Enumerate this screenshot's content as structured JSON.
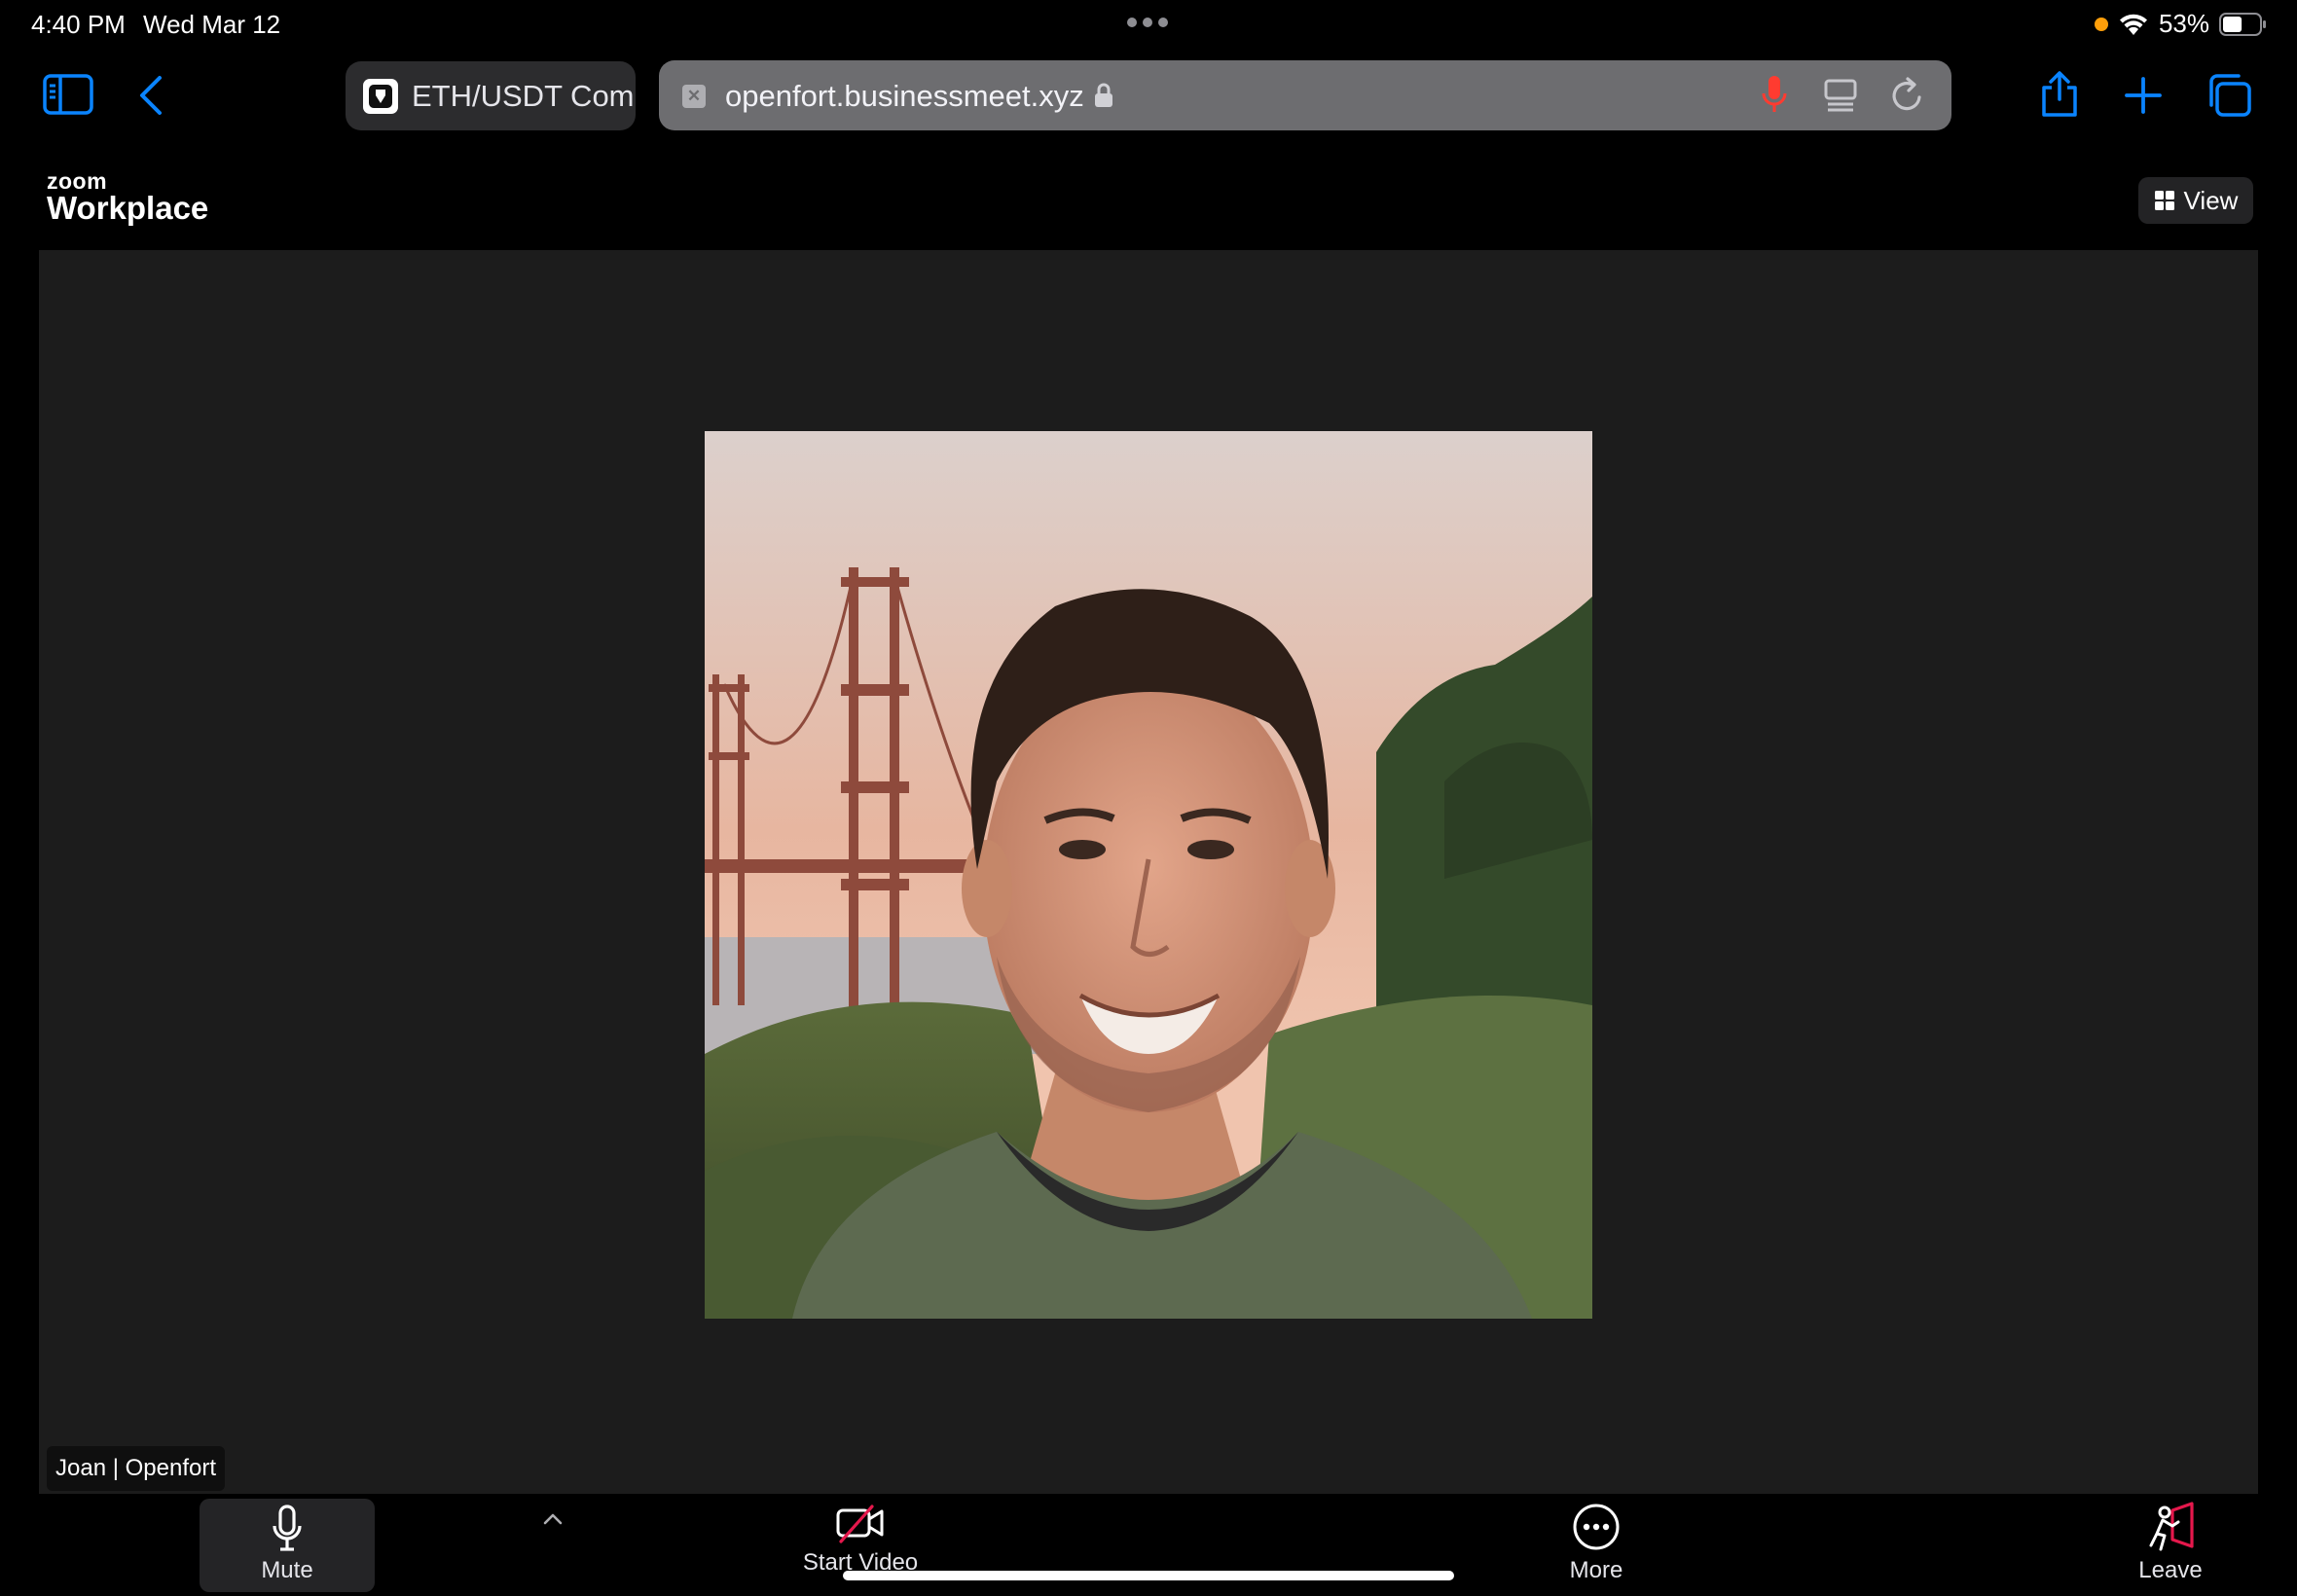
{
  "status_bar": {
    "time": "4:40 PM",
    "date": "Wed Mar 12",
    "battery_percent": "53%",
    "battery_level": 0.53,
    "icons": [
      "multitask-dots-icon",
      "orange-privacy-dot",
      "wifi-icon",
      "battery-icon"
    ]
  },
  "safari": {
    "tab_title": "ETH/USDT Com",
    "url": "openfort.businessmeet.xyz",
    "icons": [
      "sidebar-icon",
      "back-chevron-icon",
      "favicon",
      "tab-close-icon",
      "lock-icon",
      "microphone-icon",
      "reader-icon",
      "reload-icon",
      "share-icon",
      "new-tab-plus-icon",
      "tab-overview-icon"
    ],
    "colors": {
      "accent": "#0a84ff",
      "mic": "#ff3b30"
    }
  },
  "zoom": {
    "logo_small": "zoom",
    "logo_large": "Workplace",
    "view_label": "View",
    "participant_name": "Joan | Openfort",
    "toolbar": {
      "mute_label": "Mute",
      "video_label": "Start Video",
      "more_label": "More",
      "leave_label": "Leave"
    },
    "colors": {
      "background": "#1c1c1c",
      "leave_accent": "#e5184c"
    }
  }
}
